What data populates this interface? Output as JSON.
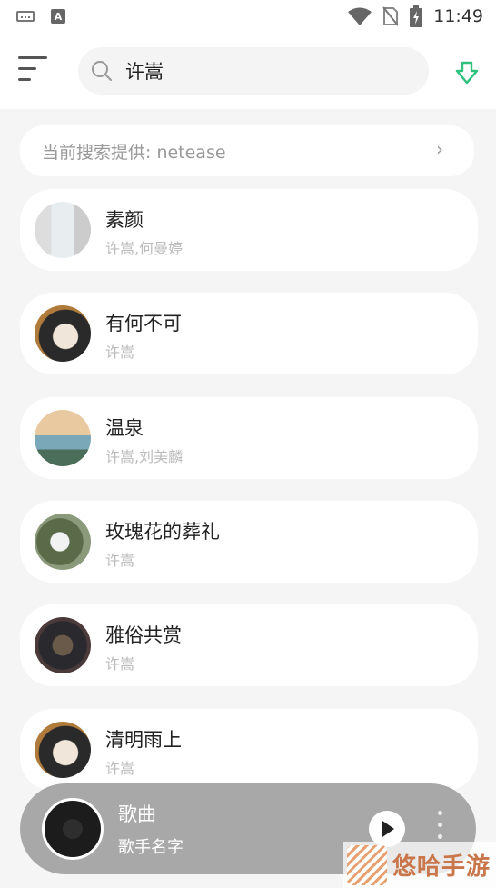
{
  "status_bar": {
    "time": "11:49",
    "a_label": "A"
  },
  "search": {
    "query": "许嵩"
  },
  "source": {
    "text": "当前搜索提供: netease",
    "chevron": "›"
  },
  "songs": [
    {
      "title": "素颜",
      "artist": "许嵩,何曼婷"
    },
    {
      "title": "有何不可",
      "artist": "许嵩"
    },
    {
      "title": "温泉",
      "artist": "许嵩,刘美麟"
    },
    {
      "title": "玫瑰花的葬礼",
      "artist": "许嵩"
    },
    {
      "title": "雅俗共赏",
      "artist": "许嵩"
    },
    {
      "title": "清明雨上",
      "artist": "许嵩"
    }
  ],
  "player": {
    "title": "歌曲",
    "artist": "歌手名字"
  },
  "watermark": {
    "text": "悠哈手游"
  },
  "colors": {
    "accent": "#2ec27e",
    "player_bg": "#a8a8a8"
  },
  "icons": [
    "keyboard-icon",
    "a-icon",
    "wifi-icon",
    "no-sim-icon",
    "battery-icon",
    "menu-icon",
    "search-icon",
    "download-icon",
    "play-icon",
    "more-icon"
  ]
}
